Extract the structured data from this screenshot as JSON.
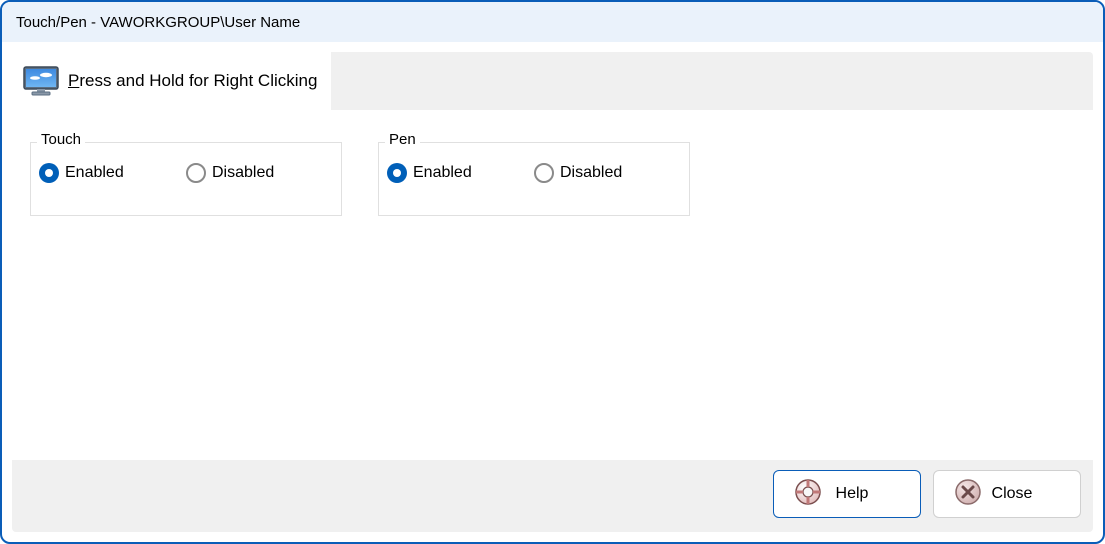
{
  "window": {
    "title": "Touch/Pen - VAWORKGROUP\\User Name"
  },
  "tab": {
    "label_prefix": "P",
    "label_rest": "ress and Hold for Right Clicking"
  },
  "groups": {
    "touch": {
      "legend": "Touch",
      "options": {
        "enabled": "Enabled",
        "disabled": "Disabled"
      },
      "selected": "enabled"
    },
    "pen": {
      "legend": "Pen",
      "options": {
        "enabled": "Enabled",
        "disabled": "Disabled"
      },
      "selected": "enabled"
    }
  },
  "buttons": {
    "help": "Help",
    "close": "Close"
  }
}
